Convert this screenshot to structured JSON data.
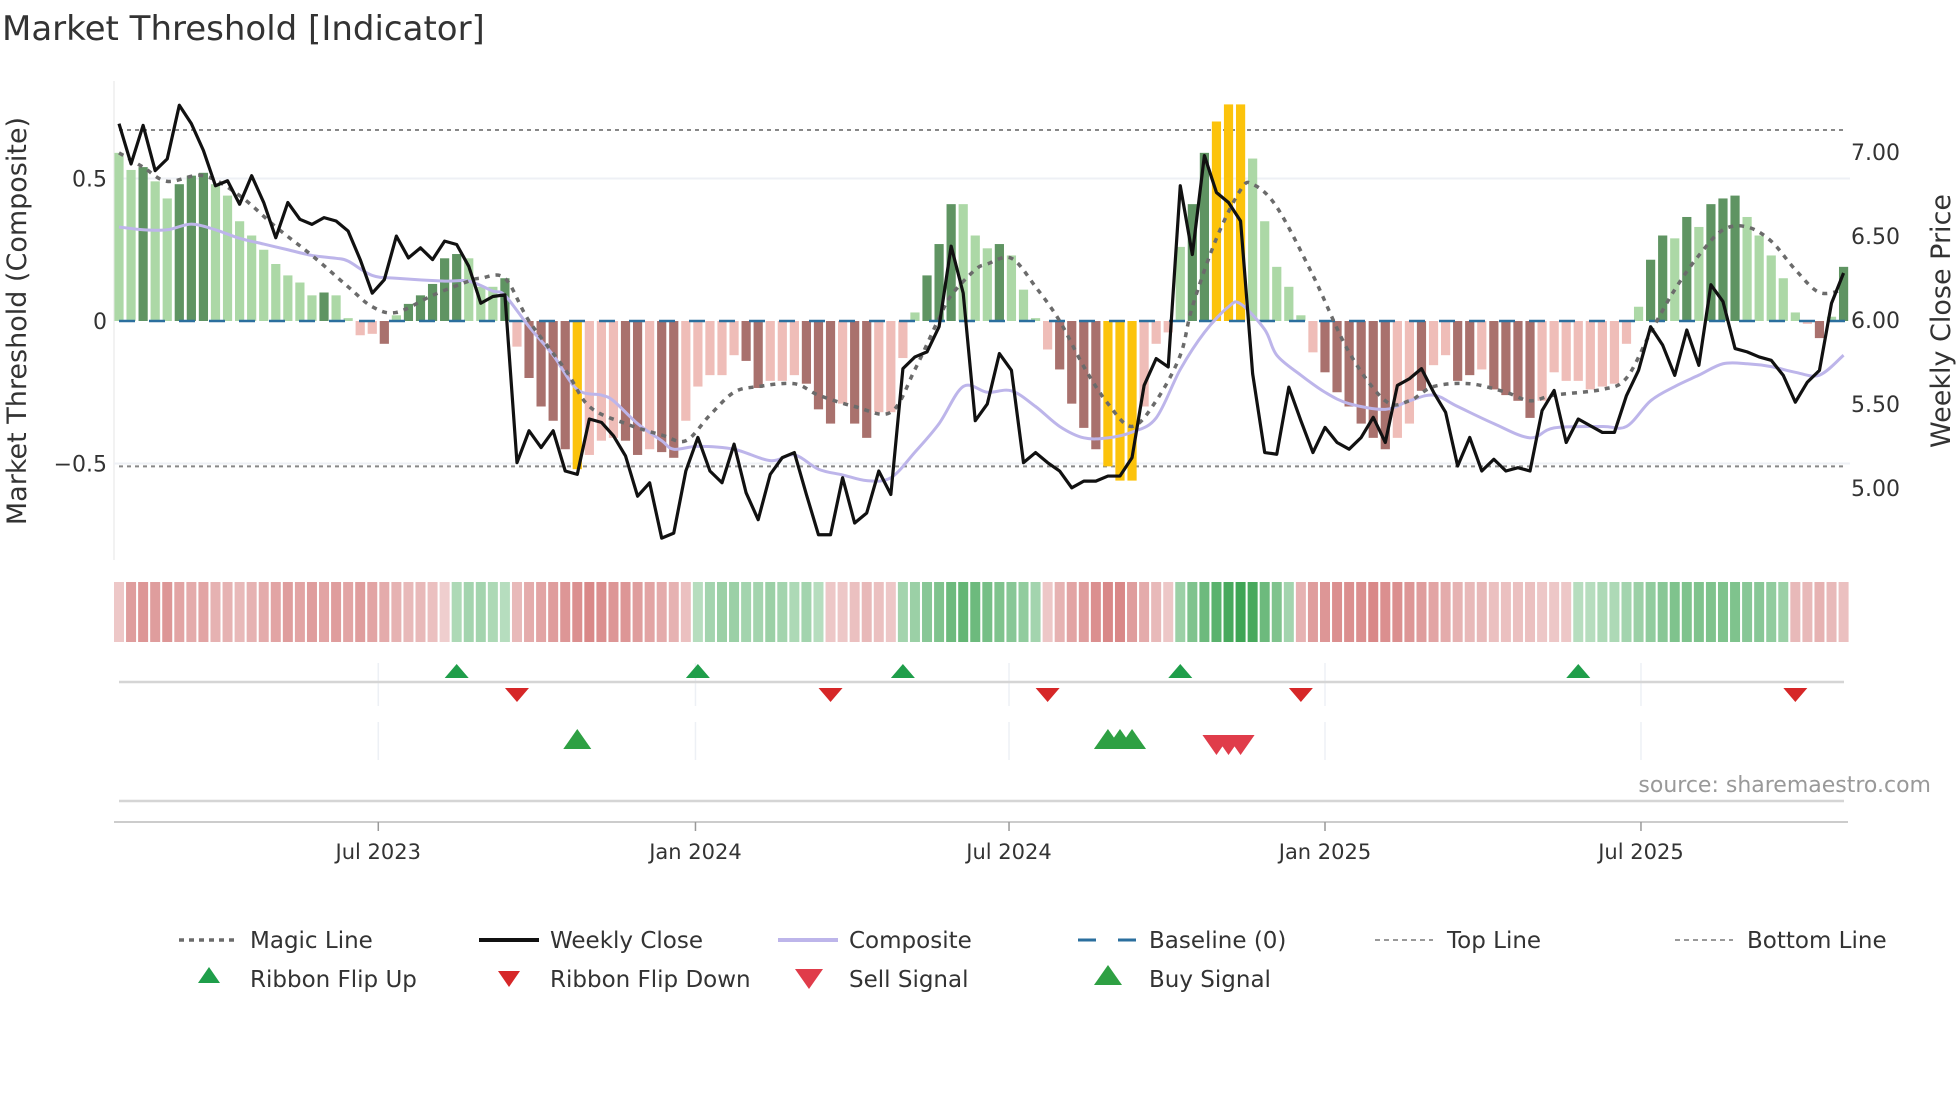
{
  "chart_data": {
    "type": "bar",
    "title": "Market Threshold [Indicator]",
    "ylabel": "Market Threshold (Composite)",
    "y2label": "Weekly Close Price",
    "ylim": [
      -0.85,
      0.82
    ],
    "y2lim": [
      4.65,
      7.45
    ],
    "yticks": [
      {
        "v": 0.5,
        "label": "0.5"
      },
      {
        "v": 0,
        "label": "0"
      },
      {
        "v": -0.5,
        "label": "−0.5"
      }
    ],
    "y2ticks": [
      {
        "v": 7.0,
        "label": "7.00"
      },
      {
        "v": 6.5,
        "label": "6.50"
      },
      {
        "v": 6.0,
        "label": "6.00"
      },
      {
        "v": 5.5,
        "label": "5.50"
      },
      {
        "v": 5.0,
        "label": "5.00"
      }
    ],
    "xticks": [
      {
        "week": 22.5,
        "label": "Jul 2023"
      },
      {
        "week": 48.8,
        "label": "Jan 2024"
      },
      {
        "week": 74.8,
        "label": "Jul 2024"
      },
      {
        "week": 101,
        "label": "Jan 2025"
      },
      {
        "week": 127.2,
        "label": "Jul 2025"
      }
    ],
    "top_line": 0.67,
    "bottom_line": -0.51,
    "baseline": 0,
    "source": "source: sharemaestro.com",
    "colors": {
      "LG": "#acd8a6",
      "DG": "#5f9462",
      "LR": "#efbdb8",
      "DR": "#a9716d",
      "Y": "#fcc30b",
      "close": "#111111",
      "composite": "#bdb5ea",
      "magic": "#6b6b6b",
      "baseline": "#2b6f9e",
      "buy": "#2ea043",
      "sell": "#e03c4a",
      "flip_up": "#1f9e4a",
      "flip_down": "#d62728"
    },
    "composite_bars": [
      0.59,
      0.53,
      0.54,
      0.49,
      0.43,
      0.48,
      0.51,
      0.52,
      0.48,
      0.44,
      0.35,
      0.3,
      0.25,
      0.2,
      0.16,
      0.135,
      0.09,
      0.1,
      0.09,
      0.01,
      -0.05,
      -0.045,
      -0.08,
      0.02,
      0.06,
      0.09,
      0.13,
      0.22,
      0.235,
      0.22,
      0.12,
      0.12,
      0.15,
      -0.09,
      -0.2,
      -0.3,
      -0.35,
      -0.45,
      -0.52,
      -0.47,
      -0.42,
      -0.41,
      -0.42,
      -0.47,
      -0.45,
      -0.46,
      -0.48,
      -0.35,
      -0.23,
      -0.19,
      -0.19,
      -0.12,
      -0.14,
      -0.235,
      -0.21,
      -0.21,
      -0.19,
      -0.22,
      -0.31,
      -0.36,
      -0.29,
      -0.36,
      -0.41,
      -0.32,
      -0.32,
      -0.13,
      0.03,
      0.16,
      0.27,
      0.41,
      0.41,
      0.3,
      0.255,
      0.27,
      0.23,
      0.11,
      0.01,
      -0.1,
      -0.17,
      -0.29,
      -0.375,
      -0.45,
      -0.51,
      -0.56,
      -0.56,
      -0.3,
      -0.08,
      -0.04,
      0.26,
      0.41,
      0.59,
      0.7,
      0.76,
      0.76,
      0.57,
      0.35,
      0.19,
      0.12,
      0.02,
      -0.11,
      -0.18,
      -0.25,
      -0.3,
      -0.36,
      -0.41,
      -0.45,
      -0.41,
      -0.36,
      -0.245,
      -0.155,
      -0.12,
      -0.21,
      -0.19,
      -0.17,
      -0.24,
      -0.26,
      -0.28,
      -0.34,
      -0.28,
      -0.18,
      -0.21,
      -0.21,
      -0.24,
      -0.23,
      -0.22,
      -0.08,
      0.05,
      0.215,
      0.3,
      0.29,
      0.365,
      0.33,
      0.41,
      0.43,
      0.44,
      0.365,
      0.3,
      0.23,
      0.15,
      0.03,
      -0.01,
      -0.06,
      0.015,
      0.19
    ],
    "bar_colors": [
      "LG",
      "LG",
      "DG",
      "LG",
      "LG",
      "DG",
      "DG",
      "DG",
      "LG",
      "LG",
      "LG",
      "LG",
      "LG",
      "LG",
      "LG",
      "LG",
      "LG",
      "DG",
      "LG",
      "LG",
      "LR",
      "LR",
      "DR",
      "LG",
      "DG",
      "DG",
      "DG",
      "DG",
      "DG",
      "LG",
      "LG",
      "LG",
      "DG",
      "LR",
      "DR",
      "DR",
      "DR",
      "DR",
      "Y",
      "LR",
      "LR",
      "LR",
      "DR",
      "DR",
      "LR",
      "DR",
      "DR",
      "LR",
      "LR",
      "LR",
      "LR",
      "LR",
      "DR",
      "DR",
      "LR",
      "LR",
      "LR",
      "DR",
      "DR",
      "DR",
      "LR",
      "DR",
      "DR",
      "LR",
      "LR",
      "LR",
      "LG",
      "DG",
      "DG",
      "DG",
      "LG",
      "LG",
      "LG",
      "DG",
      "LG",
      "LG",
      "LG",
      "LR",
      "DR",
      "DR",
      "DR",
      "DR",
      "Y",
      "Y",
      "Y",
      "LR",
      "LR",
      "LR",
      "LG",
      "DG",
      "DG",
      "Y",
      "Y",
      "Y",
      "LG",
      "LG",
      "LG",
      "LG",
      "LG",
      "LR",
      "DR",
      "DR",
      "DR",
      "DR",
      "DR",
      "DR",
      "LR",
      "LR",
      "DR",
      "LR",
      "LR",
      "DR",
      "DR",
      "LR",
      "DR",
      "DR",
      "DR",
      "DR",
      "LR",
      "LR",
      "LR",
      "LR",
      "LR",
      "LR",
      "LR",
      "LR",
      "LG",
      "DG",
      "DG",
      "LG",
      "DG",
      "LG",
      "DG",
      "DG",
      "DG",
      "LG",
      "LG",
      "LG",
      "LG",
      "LG",
      "LR",
      "DR",
      "LG",
      "DG"
    ],
    "weekly_close": [
      7.17,
      6.93,
      7.16,
      6.89,
      6.96,
      7.28,
      7.17,
      7.01,
      6.8,
      6.83,
      6.69,
      6.86,
      6.7,
      6.49,
      6.7,
      6.6,
      6.57,
      6.61,
      6.59,
      6.53,
      6.36,
      6.16,
      6.24,
      6.5,
      6.37,
      6.43,
      6.36,
      6.47,
      6.45,
      6.32,
      6.1,
      6.14,
      6.15,
      5.15,
      5.34,
      5.24,
      5.34,
      5.1,
      5.08,
      5.41,
      5.39,
      5.31,
      5.19,
      4.95,
      5.03,
      4.7,
      4.73,
      5.1,
      5.3,
      5.1,
      5.03,
      5.26,
      4.97,
      4.81,
      5.08,
      5.18,
      5.21,
      4.96,
      4.72,
      4.72,
      5.06,
      4.79,
      4.85,
      5.1,
      4.96,
      5.71,
      5.78,
      5.81,
      5.96,
      6.44,
      6.16,
      5.4,
      5.5,
      5.8,
      5.7,
      5.15,
      5.21,
      5.15,
      5.1,
      5.0,
      5.04,
      5.04,
      5.07,
      5.07,
      5.18,
      5.61,
      5.77,
      5.72,
      6.8,
      6.39,
      6.98,
      6.76,
      6.7,
      6.59,
      5.68,
      5.21,
      5.2,
      5.6,
      5.4,
      5.21,
      5.36,
      5.27,
      5.23,
      5.3,
      5.42,
      5.27,
      5.61,
      5.65,
      5.71,
      5.57,
      5.45,
      5.13,
      5.3,
      5.1,
      5.17,
      5.1,
      5.12,
      5.1,
      5.46,
      5.58,
      5.27,
      5.41,
      5.37,
      5.33,
      5.33,
      5.55,
      5.7,
      5.96,
      5.85,
      5.67,
      5.94,
      5.73,
      6.21,
      6.11,
      5.83,
      5.81,
      5.78,
      5.76,
      5.67,
      5.51,
      5.63,
      5.7,
      6.1,
      6.28
    ],
    "magic_line": [
      [
        1,
        0.59
      ],
      [
        3,
        0.54
      ],
      [
        5,
        0.49
      ],
      [
        8,
        0.51
      ],
      [
        11,
        0.44
      ],
      [
        14,
        0.33
      ],
      [
        17,
        0.23
      ],
      [
        20,
        0.12
      ],
      [
        22,
        0.05
      ],
      [
        24,
        0.03
      ],
      [
        27,
        0.09
      ],
      [
        30,
        0.14
      ],
      [
        31,
        0.15
      ],
      [
        33,
        0.15
      ],
      [
        35,
        0.0
      ],
      [
        38,
        -0.17
      ],
      [
        40,
        -0.3
      ],
      [
        43,
        -0.36
      ],
      [
        46,
        -0.4
      ],
      [
        48,
        -0.42
      ],
      [
        50,
        -0.33
      ],
      [
        52,
        -0.25
      ],
      [
        54,
        -0.23
      ],
      [
        57,
        -0.22
      ],
      [
        59,
        -0.26
      ],
      [
        62,
        -0.3
      ],
      [
        65,
        -0.32
      ],
      [
        67,
        -0.17
      ],
      [
        69,
        0.01
      ],
      [
        70,
        0.09
      ],
      [
        72,
        0.18
      ],
      [
        73,
        0.2
      ],
      [
        75,
        0.22
      ],
      [
        77,
        0.12
      ],
      [
        79,
        0.0
      ],
      [
        81,
        -0.16
      ],
      [
        83,
        -0.29
      ],
      [
        85,
        -0.37
      ],
      [
        87,
        -0.28
      ],
      [
        89,
        -0.12
      ],
      [
        90,
        0.05
      ],
      [
        92,
        0.29
      ],
      [
        94,
        0.46
      ],
      [
        95,
        0.48
      ],
      [
        97,
        0.4
      ],
      [
        100,
        0.16
      ],
      [
        103,
        -0.11
      ],
      [
        106,
        -0.28
      ],
      [
        108,
        -0.28
      ],
      [
        110,
        -0.23
      ],
      [
        113,
        -0.22
      ],
      [
        116,
        -0.25
      ],
      [
        118,
        -0.28
      ],
      [
        120,
        -0.26
      ],
      [
        124,
        -0.24
      ],
      [
        126,
        -0.2
      ],
      [
        128,
        -0.04
      ],
      [
        130,
        0.11
      ],
      [
        132,
        0.23
      ],
      [
        134,
        0.32
      ],
      [
        136,
        0.33
      ],
      [
        138,
        0.28
      ],
      [
        140,
        0.18
      ],
      [
        142,
        0.1
      ],
      [
        144,
        0.11
      ]
    ],
    "composite_line": [
      [
        1,
        0.33
      ],
      [
        3,
        0.32
      ],
      [
        5,
        0.32
      ],
      [
        7,
        0.34
      ],
      [
        9,
        0.32
      ],
      [
        11,
        0.29
      ],
      [
        13,
        0.27
      ],
      [
        15,
        0.25
      ],
      [
        17,
        0.23
      ],
      [
        19,
        0.22
      ],
      [
        20,
        0.21
      ],
      [
        22,
        0.16
      ],
      [
        24,
        0.15
      ],
      [
        28,
        0.14
      ],
      [
        30,
        0.14
      ],
      [
        32,
        0.105
      ],
      [
        33,
        0.09
      ],
      [
        35,
        -0.02
      ],
      [
        37,
        -0.12
      ],
      [
        39,
        -0.24
      ],
      [
        41,
        -0.26
      ],
      [
        42,
        -0.28
      ],
      [
        44,
        -0.36
      ],
      [
        46,
        -0.42
      ],
      [
        47,
        -0.45
      ],
      [
        49,
        -0.44
      ],
      [
        52,
        -0.45
      ],
      [
        55,
        -0.49
      ],
      [
        57,
        -0.47
      ],
      [
        59,
        -0.52
      ],
      [
        61,
        -0.54
      ],
      [
        63,
        -0.56
      ],
      [
        65,
        -0.55
      ],
      [
        67,
        -0.46
      ],
      [
        69,
        -0.36
      ],
      [
        71,
        -0.23
      ],
      [
        73,
        -0.25
      ],
      [
        75,
        -0.245
      ],
      [
        77,
        -0.3
      ],
      [
        79,
        -0.37
      ],
      [
        81,
        -0.41
      ],
      [
        83,
        -0.41
      ],
      [
        85,
        -0.39
      ],
      [
        87,
        -0.34
      ],
      [
        89,
        -0.17
      ],
      [
        91,
        -0.04
      ],
      [
        93,
        0.05
      ],
      [
        94,
        0.06
      ],
      [
        96,
        -0.03
      ],
      [
        97,
        -0.12
      ],
      [
        99,
        -0.19
      ],
      [
        101,
        -0.25
      ],
      [
        103,
        -0.29
      ],
      [
        106,
        -0.31
      ],
      [
        108,
        -0.28
      ],
      [
        110,
        -0.26
      ],
      [
        112,
        -0.3
      ],
      [
        115,
        -0.36
      ],
      [
        118,
        -0.41
      ],
      [
        120,
        -0.375
      ],
      [
        124,
        -0.37
      ],
      [
        126,
        -0.37
      ],
      [
        128,
        -0.28
      ],
      [
        130,
        -0.23
      ],
      [
        132,
        -0.19
      ],
      [
        134,
        -0.15
      ],
      [
        136,
        -0.15
      ],
      [
        138,
        -0.16
      ],
      [
        140,
        -0.18
      ],
      [
        142,
        -0.19
      ],
      [
        144,
        -0.12
      ]
    ],
    "ribbon": [
      -0.2,
      -0.5,
      -0.55,
      -0.5,
      -0.55,
      -0.45,
      -0.4,
      -0.45,
      -0.35,
      -0.35,
      -0.3,
      -0.35,
      -0.4,
      -0.45,
      -0.5,
      -0.45,
      -0.5,
      -0.45,
      -0.5,
      -0.45,
      -0.5,
      -0.45,
      -0.4,
      -0.35,
      -0.3,
      -0.3,
      -0.25,
      -0.15,
      0.25,
      0.3,
      0.3,
      0.25,
      0.2,
      -0.3,
      -0.4,
      -0.45,
      -0.5,
      -0.55,
      -0.6,
      -0.65,
      -0.6,
      -0.55,
      -0.55,
      -0.5,
      -0.45,
      -0.4,
      -0.35,
      -0.25,
      0.2,
      0.3,
      0.35,
      0.35,
      0.3,
      0.3,
      0.35,
      0.3,
      0.25,
      0.3,
      0.2,
      -0.2,
      -0.2,
      -0.25,
      -0.3,
      -0.25,
      -0.2,
      0.3,
      0.35,
      0.45,
      0.5,
      0.6,
      0.65,
      0.6,
      0.55,
      0.5,
      0.45,
      0.4,
      0.3,
      -0.2,
      -0.35,
      -0.45,
      -0.5,
      -0.6,
      -0.65,
      -0.65,
      -0.5,
      -0.4,
      -0.3,
      -0.2,
      0.35,
      0.5,
      0.6,
      0.7,
      0.8,
      0.85,
      0.8,
      0.6,
      0.5,
      0.3,
      -0.35,
      -0.5,
      -0.55,
      -0.6,
      -0.6,
      -0.6,
      -0.65,
      -0.6,
      -0.6,
      -0.55,
      -0.5,
      -0.45,
      -0.4,
      -0.35,
      -0.3,
      -0.3,
      -0.25,
      -0.25,
      -0.25,
      -0.25,
      -0.2,
      -0.2,
      -0.2,
      0.2,
      0.2,
      0.25,
      0.25,
      0.3,
      0.35,
      0.4,
      0.45,
      0.5,
      0.5,
      0.5,
      0.5,
      0.5,
      0.5,
      0.45,
      0.45,
      0.4,
      0.35,
      -0.3,
      -0.3,
      -0.35,
      -0.3,
      -0.25
    ],
    "ribbon_flip_up_weeks": [
      29,
      49,
      66,
      89,
      122
    ],
    "ribbon_flip_down_weeks": [
      34,
      60,
      78,
      99,
      140
    ],
    "buy_signal_weeks": [
      39,
      83,
      84,
      85
    ],
    "sell_signal_weeks": [
      92,
      93,
      94
    ],
    "legend": [
      {
        "key": "magic",
        "label": "Magic Line"
      },
      {
        "key": "close",
        "label": "Weekly Close"
      },
      {
        "key": "composite",
        "label": "Composite"
      },
      {
        "key": "baseline",
        "label": "Baseline (0)"
      },
      {
        "key": "top",
        "label": "Top Line"
      },
      {
        "key": "bottom",
        "label": "Bottom Line"
      },
      {
        "key": "flip_up",
        "label": "Ribbon Flip Up"
      },
      {
        "key": "flip_down",
        "label": "Ribbon Flip Down"
      },
      {
        "key": "sell",
        "label": "Sell Signal"
      },
      {
        "key": "buy",
        "label": "Buy Signal"
      }
    ],
    "legend_position": "bottom"
  }
}
